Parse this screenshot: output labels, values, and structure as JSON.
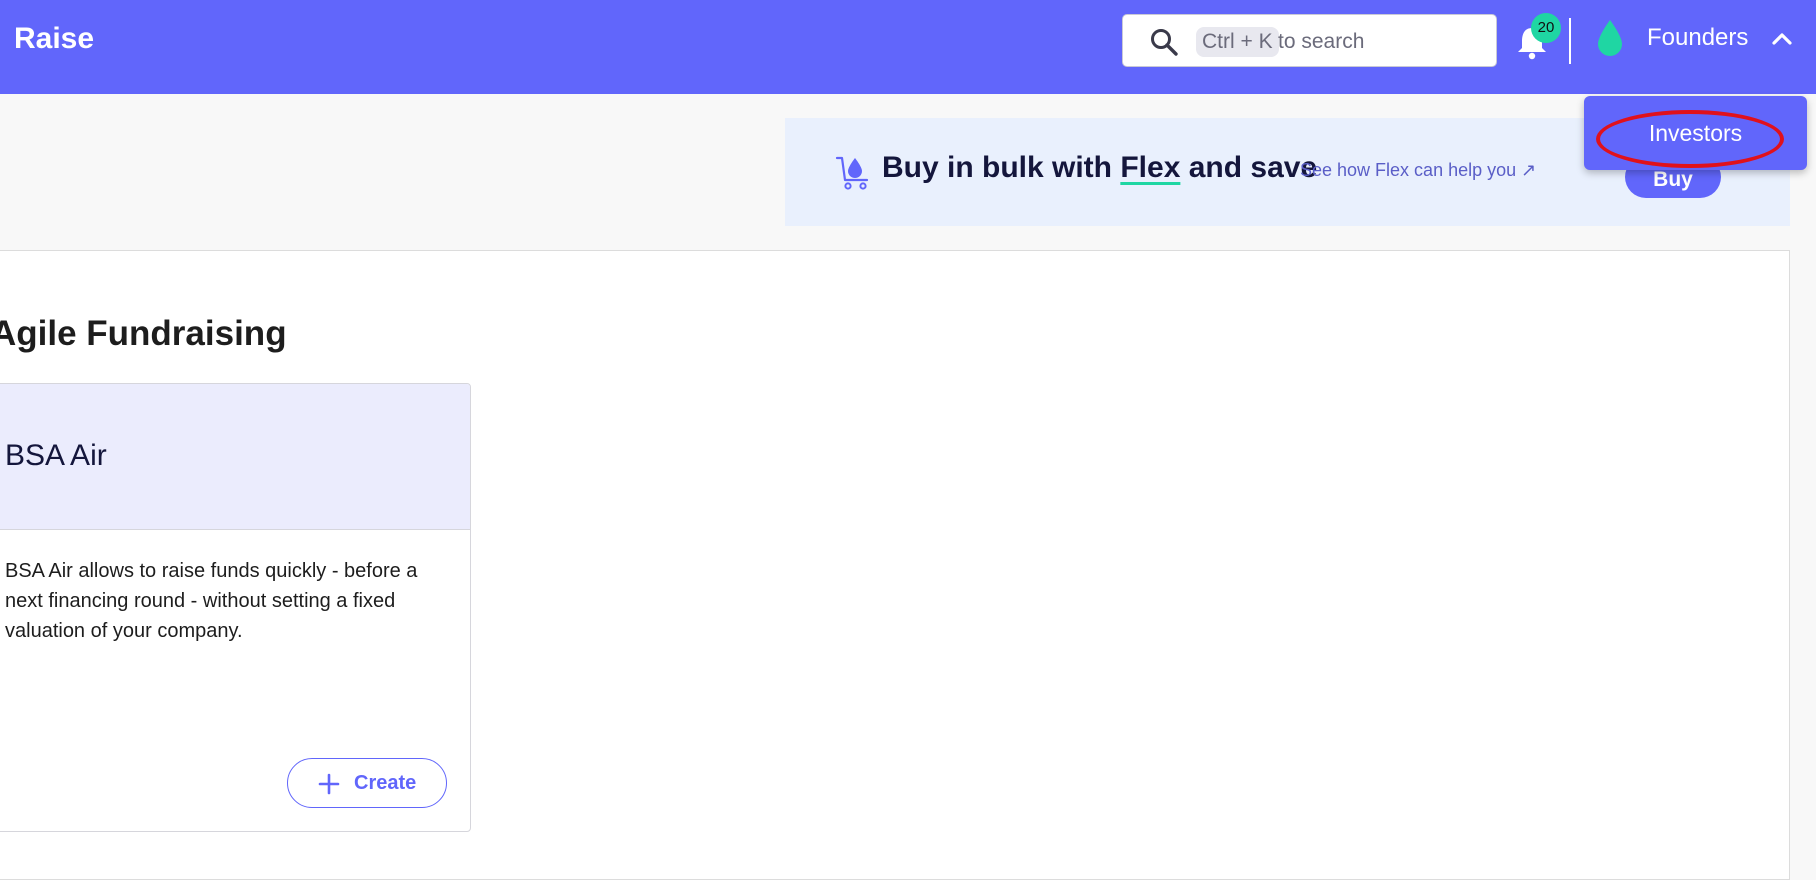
{
  "app": {
    "title": "Raise"
  },
  "header": {
    "search": {
      "shortcut": "Ctrl + K",
      "placeholder_suffix": "to search"
    },
    "notifications": {
      "count": "20"
    },
    "user_menu": {
      "label": "Founders",
      "expanded": true
    }
  },
  "dropdown": {
    "items": [
      {
        "label": "Investors"
      }
    ]
  },
  "promo": {
    "title_prefix": "Buy in bulk with",
    "title_flex": "Flex",
    "title_suffix": "and save",
    "link": "See how Flex can help you ↗",
    "button": "Buy"
  },
  "section": {
    "title": "Agile Fundraising"
  },
  "cards": [
    {
      "title": "BSA Air",
      "description": "BSA Air allows to raise funds quickly - before a next financing round - without setting a fixed valuation of your company.",
      "button": "Create"
    }
  ],
  "colors": {
    "primary": "#6166fb",
    "accent": "#1fd6a3",
    "annotation": "#e0111c",
    "promo_bg": "#e9f0fd",
    "card_head_bg": "#ebecfd"
  },
  "icons": [
    "search-icon",
    "bell-icon",
    "drop-icon",
    "chevron-up-icon",
    "cart-drop-icon",
    "plus-icon"
  ]
}
